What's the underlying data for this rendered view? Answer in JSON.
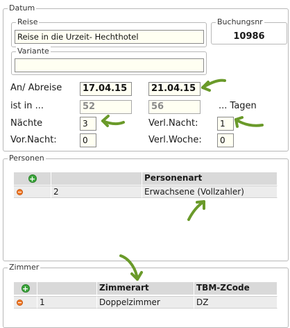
{
  "datum": {
    "legend": "Datum",
    "reise": {
      "legend": "Reise",
      "value": "Reise in die Urzeit- Hechthotel"
    },
    "buchungsnr": {
      "legend": "Buchungsnr",
      "value": "10986"
    },
    "variante": {
      "legend": "Variante",
      "value": ""
    },
    "an_abreise": {
      "label": "An/ Abreise",
      "an": "17.04.15",
      "ab": "21.04.15"
    },
    "ist_in": {
      "label": "ist in ...",
      "value1": "52",
      "value2": "56",
      "suffix": "... Tagen"
    },
    "naechte": {
      "label": "Nächte",
      "value": "3"
    },
    "verl_nacht": {
      "label": "Verl.Nacht:",
      "value": "1"
    },
    "vor_nacht": {
      "label": "Vor.Nacht:",
      "value": "0"
    },
    "verl_woche": {
      "label": "Verl.Woche:",
      "value": "0"
    }
  },
  "personen": {
    "legend": "Personen",
    "header": [
      "",
      "",
      "Personenart"
    ],
    "rows": [
      {
        "count": "2",
        "art": "Erwachsene (Vollzahler)"
      }
    ]
  },
  "zimmer": {
    "legend": "Zimmer",
    "header": [
      "",
      "",
      "Zimmerart",
      "TBM-ZCode"
    ],
    "rows": [
      {
        "count": "1",
        "art": "Doppelzimmer",
        "code": "DZ"
      }
    ]
  },
  "colors": {
    "arrow": "#6a9a2a",
    "plus": "#3aa53a",
    "minus": "#f07a2a"
  }
}
